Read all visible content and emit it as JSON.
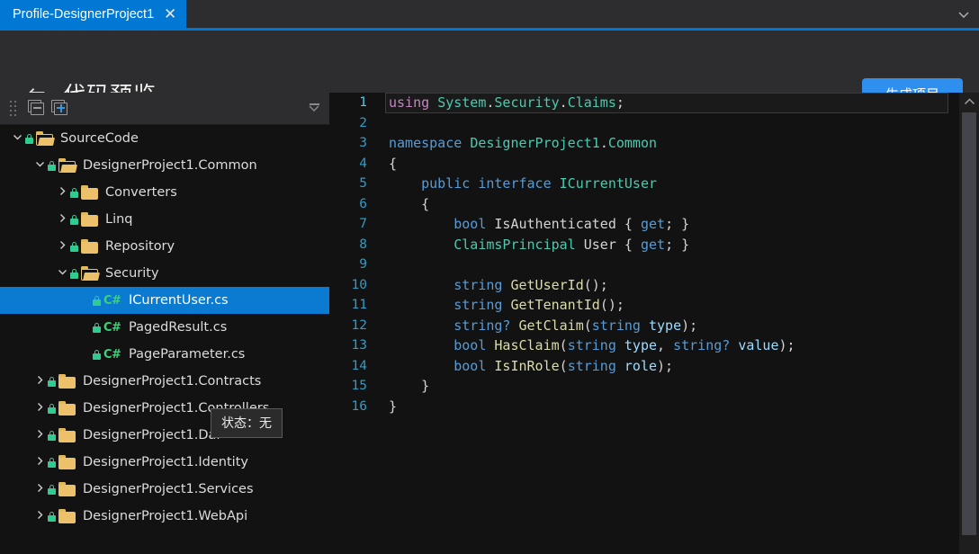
{
  "tabbar": {
    "tabs": [
      {
        "label": "Profile-DesignerProject1",
        "close_icon": "close-icon",
        "active": true
      }
    ],
    "overflow_icon": "chevron-down-icon"
  },
  "header": {
    "back_icon": "arrow-left-icon",
    "title": "代码预览",
    "generate_button": "生成项目"
  },
  "tree_toolbar": {
    "grip": "drag-grip-icon",
    "collapse_all": "collapse-all-icon",
    "expand_all": "expand-all-icon",
    "overflow": "toolbar-overflow-icon"
  },
  "tooltip": {
    "text": "状态：无"
  },
  "tree": {
    "items": [
      {
        "label": "SourceCode",
        "indent": 0,
        "type": "folder-open",
        "chevron": "v",
        "locked": true,
        "selected": false
      },
      {
        "label": "DesignerProject1.Common",
        "indent": 1,
        "type": "folder-open",
        "chevron": "v",
        "locked": true,
        "selected": false
      },
      {
        "label": "Converters",
        "indent": 2,
        "type": "folder-closed",
        "chevron": ">",
        "locked": true,
        "selected": false
      },
      {
        "label": "Linq",
        "indent": 2,
        "type": "folder-closed",
        "chevron": ">",
        "locked": true,
        "selected": false
      },
      {
        "label": "Repository",
        "indent": 2,
        "type": "folder-closed",
        "chevron": ">",
        "locked": true,
        "selected": false
      },
      {
        "label": "Security",
        "indent": 2,
        "type": "folder-open",
        "chevron": "v",
        "locked": true,
        "selected": false
      },
      {
        "label": "ICurrentUser.cs",
        "indent": 3,
        "type": "csharp",
        "chevron": "",
        "locked": true,
        "selected": true
      },
      {
        "label": "PagedResult.cs",
        "indent": 3,
        "type": "csharp",
        "chevron": "",
        "locked": true,
        "selected": false
      },
      {
        "label": "PageParameter.cs",
        "indent": 3,
        "type": "csharp",
        "chevron": "",
        "locked": true,
        "selected": false
      },
      {
        "label": "DesignerProject1.Contracts",
        "indent": 1,
        "type": "folder-closed",
        "chevron": ">",
        "locked": true,
        "selected": false
      },
      {
        "label": "DesignerProject1.Controllers",
        "indent": 1,
        "type": "folder-closed",
        "chevron": ">",
        "locked": true,
        "selected": false
      },
      {
        "label": "DesignerProject1.Dal",
        "indent": 1,
        "type": "folder-closed",
        "chevron": ">",
        "locked": true,
        "selected": false
      },
      {
        "label": "DesignerProject1.Identity",
        "indent": 1,
        "type": "folder-closed",
        "chevron": ">",
        "locked": true,
        "selected": false
      },
      {
        "label": "DesignerProject1.Services",
        "indent": 1,
        "type": "folder-closed",
        "chevron": ">",
        "locked": true,
        "selected": false
      },
      {
        "label": "DesignerProject1.WebApi",
        "indent": 1,
        "type": "folder-closed",
        "chevron": ">",
        "locked": true,
        "selected": false
      }
    ]
  },
  "editor": {
    "scroll_up_icon": "chevron-up-icon",
    "active_line": 1,
    "lines": [
      {
        "n": 1,
        "tokens": [
          {
            "t": "using ",
            "c": "ctrl"
          },
          {
            "t": "System",
            "c": "type"
          },
          {
            "t": ".",
            "c": "pl"
          },
          {
            "t": "Security",
            "c": "type"
          },
          {
            "t": ".",
            "c": "pl"
          },
          {
            "t": "Claims",
            "c": "type"
          },
          {
            "t": ";",
            "c": "pl"
          }
        ]
      },
      {
        "n": 2,
        "tokens": []
      },
      {
        "n": 3,
        "tokens": [
          {
            "t": "namespace ",
            "c": "key"
          },
          {
            "t": "DesignerProject1",
            "c": "type"
          },
          {
            "t": ".",
            "c": "pl"
          },
          {
            "t": "Common",
            "c": "type"
          }
        ]
      },
      {
        "n": 4,
        "tokens": [
          {
            "t": "{",
            "c": "pl"
          }
        ]
      },
      {
        "n": 5,
        "tokens": [
          {
            "t": "    ",
            "c": "pl"
          },
          {
            "t": "public ",
            "c": "key"
          },
          {
            "t": "interface ",
            "c": "key"
          },
          {
            "t": "ICurrentUser",
            "c": "type"
          }
        ]
      },
      {
        "n": 6,
        "tokens": [
          {
            "t": "    {",
            "c": "pl"
          }
        ]
      },
      {
        "n": 7,
        "tokens": [
          {
            "t": "        ",
            "c": "pl"
          },
          {
            "t": "bool ",
            "c": "key"
          },
          {
            "t": "IsAuthenticated",
            "c": "pl"
          },
          {
            "t": " { ",
            "c": "pl"
          },
          {
            "t": "get",
            "c": "key"
          },
          {
            "t": "; }",
            "c": "pl"
          }
        ]
      },
      {
        "n": 8,
        "tokens": [
          {
            "t": "        ",
            "c": "pl"
          },
          {
            "t": "ClaimsPrincipal",
            "c": "type"
          },
          {
            "t": " User { ",
            "c": "pl"
          },
          {
            "t": "get",
            "c": "key"
          },
          {
            "t": "; }",
            "c": "pl"
          }
        ]
      },
      {
        "n": 9,
        "tokens": []
      },
      {
        "n": 10,
        "tokens": [
          {
            "t": "        ",
            "c": "pl"
          },
          {
            "t": "string ",
            "c": "key"
          },
          {
            "t": "GetUserId",
            "c": "fn"
          },
          {
            "t": "();",
            "c": "pl"
          }
        ]
      },
      {
        "n": 11,
        "tokens": [
          {
            "t": "        ",
            "c": "pl"
          },
          {
            "t": "string ",
            "c": "key"
          },
          {
            "t": "GetTenantId",
            "c": "fn"
          },
          {
            "t": "();",
            "c": "pl"
          }
        ]
      },
      {
        "n": 12,
        "tokens": [
          {
            "t": "        ",
            "c": "pl"
          },
          {
            "t": "string? ",
            "c": "key"
          },
          {
            "t": "GetClaim",
            "c": "fn"
          },
          {
            "t": "(",
            "c": "pl"
          },
          {
            "t": "string ",
            "c": "key"
          },
          {
            "t": "type",
            "c": "var"
          },
          {
            "t": ");",
            "c": "pl"
          }
        ]
      },
      {
        "n": 13,
        "tokens": [
          {
            "t": "        ",
            "c": "pl"
          },
          {
            "t": "bool ",
            "c": "key"
          },
          {
            "t": "HasClaim",
            "c": "fn"
          },
          {
            "t": "(",
            "c": "pl"
          },
          {
            "t": "string ",
            "c": "key"
          },
          {
            "t": "type",
            "c": "var"
          },
          {
            "t": ", ",
            "c": "pl"
          },
          {
            "t": "string? ",
            "c": "key"
          },
          {
            "t": "value",
            "c": "var"
          },
          {
            "t": ");",
            "c": "pl"
          }
        ]
      },
      {
        "n": 14,
        "tokens": [
          {
            "t": "        ",
            "c": "pl"
          },
          {
            "t": "bool ",
            "c": "key"
          },
          {
            "t": "IsInRole",
            "c": "fn"
          },
          {
            "t": "(",
            "c": "pl"
          },
          {
            "t": "string ",
            "c": "key"
          },
          {
            "t": "role",
            "c": "var"
          },
          {
            "t": ");",
            "c": "pl"
          }
        ]
      },
      {
        "n": 15,
        "tokens": [
          {
            "t": "    }",
            "c": "pl"
          }
        ]
      },
      {
        "n": 16,
        "tokens": [
          {
            "t": "}",
            "c": "pl"
          }
        ]
      }
    ]
  },
  "colors": {
    "accent": "#0078d4",
    "button": "#2f8fef",
    "selection": "#0a7bd0",
    "folder": "#edc06a",
    "lock": "#2ecc8f",
    "csharp": "#3fd17a",
    "keyword": "#569cd6",
    "type": "#4ec9b0",
    "method": "#dcdcaa",
    "directive": "#c586c0",
    "param": "#9cdcfe",
    "line_number": "#2e9dc8"
  }
}
